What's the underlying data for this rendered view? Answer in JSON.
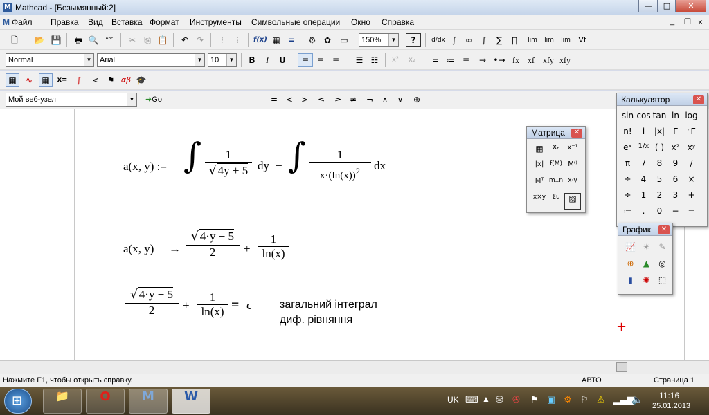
{
  "window": {
    "app_icon": "M",
    "title": "Mathcad - [Безымянный:2]",
    "controls": {
      "minimize": "—",
      "maximize": "□",
      "close": "✕"
    },
    "doc_controls": {
      "minimize": "_",
      "restore": "❐",
      "close": "×"
    }
  },
  "menu": {
    "doc_icon": "M",
    "items": [
      "Файл",
      "Правка",
      "Вид",
      "Вставка",
      "Формат",
      "Инструменты",
      "Символьные операции",
      "Окно",
      "Справка"
    ]
  },
  "standard_toolbar": {
    "zoom": "150%",
    "buttons": [
      "🗋",
      "📂",
      "💾",
      "🖶",
      "🔍",
      "ᴬᴮᶜ",
      "✂",
      "⎘",
      "📋",
      "↶",
      "↷",
      "⁝",
      "⁞",
      "f(x)",
      "▦",
      "=",
      "▭",
      "⚙",
      "✿",
      "▣",
      "?"
    ]
  },
  "calculus_toolbar": {
    "buttons": [
      "d/dx",
      "∫",
      "∞",
      "∫",
      "∑",
      "∏",
      "lim",
      "lim",
      "lim",
      "∇f"
    ]
  },
  "format_toolbar": {
    "style": "Normal",
    "font": "Arial",
    "size": "10",
    "buttons": [
      "B",
      "I",
      "U",
      "≡",
      "≡",
      "≡",
      "☰",
      "☷",
      "x²",
      "x₂"
    ]
  },
  "evaluation_toolbar": {
    "buttons": [
      "=",
      "≔",
      "≡",
      "→",
      "•→",
      "fx",
      "xf",
      "xfy",
      "xfy"
    ]
  },
  "math_toolbar": {
    "buttons": [
      "▦",
      "∿",
      "▦",
      "x=",
      "∫",
      "<",
      "⚑",
      "αβ",
      "🎓"
    ]
  },
  "resources": {
    "url": "Мой веб-узел",
    "go": "Go"
  },
  "boolean_toolbar": {
    "buttons": [
      "=",
      "<",
      ">",
      "≤",
      "≥",
      "≠",
      "¬",
      "∧",
      "∨",
      "⊕"
    ]
  },
  "worksheet": {
    "def": {
      "lhs": "a(x, y) :=",
      "int1_num": "1",
      "int1_den": "4y + 5",
      "int1_d": "dy",
      "minus": "−",
      "int2_num": "1",
      "int2_den": "x·(ln(x))",
      "int2_exp": "2",
      "int2_d": "dx"
    },
    "symbolic": {
      "lhs": "a(x, y)",
      "arrow": "→",
      "frac1_num": "4·y + 5",
      "frac1_den": "2",
      "plus": "+",
      "frac2_num": "1",
      "frac2_den": "ln(x)"
    },
    "equation": {
      "frac1_num": "4·y + 5",
      "frac1_den": "2",
      "plus": "+",
      "frac2_num": "1",
      "frac2_den": "ln(x)",
      "eq": "=",
      "rhs": "c"
    },
    "note": {
      "line1": "загальний інтеграл",
      "line2": "диф. рівняння"
    },
    "cursor": "+"
  },
  "matrix_palette": {
    "title": "Матрица",
    "buttons": [
      "▦",
      "Xₙ",
      "x⁻¹",
      "|x|",
      "f(M)",
      "M⁽⁾",
      "Mᵀ",
      "m..n",
      "x·y",
      "x×y",
      "Σu",
      "▨"
    ]
  },
  "calculator_palette": {
    "title": "Калькулятор",
    "buttons": [
      "sin",
      "cos",
      "tan",
      "ln",
      "log",
      "n!",
      "i",
      "|x|",
      "Γ",
      "ⁿΓ",
      "eˣ",
      "1/x",
      "( )",
      "x²",
      "xʸ",
      "π",
      "7",
      "8",
      "9",
      "/",
      "÷",
      "4",
      "5",
      "6",
      "×",
      "÷",
      "1",
      "2",
      "3",
      "+",
      "≔",
      ".",
      "0",
      "−",
      "="
    ]
  },
  "graph_palette": {
    "title": "График",
    "buttons": [
      "📈",
      "✴",
      "✎",
      "⊕",
      "▲",
      "◎",
      "▮",
      "✺",
      "⬚"
    ]
  },
  "status": {
    "help": "Нажмите F1, чтобы открыть справку.",
    "mode": "АВТО",
    "page": "Страница 1"
  },
  "taskbar": {
    "apps": [
      "📁",
      "O",
      "M",
      "W"
    ],
    "lang": "UK",
    "time": "11:16",
    "date": "25.01.2013"
  }
}
